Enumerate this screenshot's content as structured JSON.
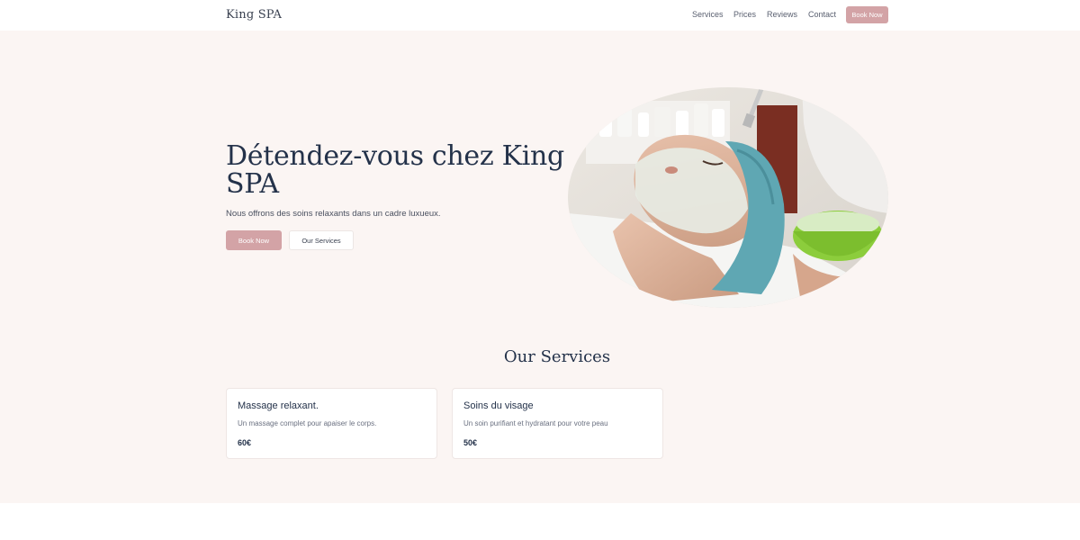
{
  "header": {
    "logo": "King SPA",
    "nav": [
      "Services",
      "Prices",
      "Reviews",
      "Contact"
    ],
    "cta": "Book Now"
  },
  "hero": {
    "title": "Détendez-vous chez King SPA",
    "subtitle": "Nous offrons des soins relaxants dans un cadre luxueux.",
    "primary_button": "Book Now",
    "secondary_button": "Our Services"
  },
  "services": {
    "title": "Our Services",
    "items": [
      {
        "title": "Massage relaxant.",
        "description": "Un massage complet pour apaiser le corps.",
        "price": "60€"
      },
      {
        "title": "Soins du visage",
        "description": "Un soin purifiant et hydratant pour votre peau",
        "price": "50€"
      }
    ]
  },
  "colors": {
    "accent": "#d3a3a6",
    "background": "#fbf5f3",
    "heading": "#24324a"
  }
}
